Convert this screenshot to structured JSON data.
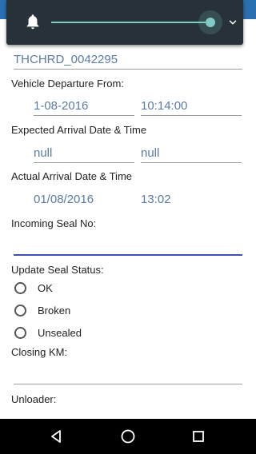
{
  "form": {
    "trip_id": "THCHRD_0042295",
    "departure_label": "Vehicle Departure From:",
    "departure_date": "1-08-2016",
    "departure_time": "10:14:00",
    "expected_label": "Expected Arrival Date  & Time",
    "expected_date": "null",
    "expected_time": "null",
    "actual_label": "Actual Arrival Date  & Time",
    "actual_date": "01/08/2016",
    "actual_time": "13:02",
    "incoming_seal_label": "Incoming Seal No:",
    "incoming_seal_value": "",
    "seal_status_label": "Update Seal Status:",
    "seal_options": [
      "OK",
      "Broken",
      "Unsealed"
    ],
    "closing_km_label": "Closing KM:",
    "closing_km_value": "",
    "unloader_label": "Unloader:"
  },
  "colors": {
    "shade_bg": "#263238",
    "accent": "#80cbc4",
    "active_underline": "#3f51b5",
    "value_text": "#5a7aa8"
  },
  "shade": {
    "volume_level": 0.95,
    "icons": [
      "bell-icon",
      "chevron-down-icon"
    ]
  },
  "nav": {
    "icons": [
      "back-icon",
      "home-icon",
      "recents-icon"
    ]
  }
}
